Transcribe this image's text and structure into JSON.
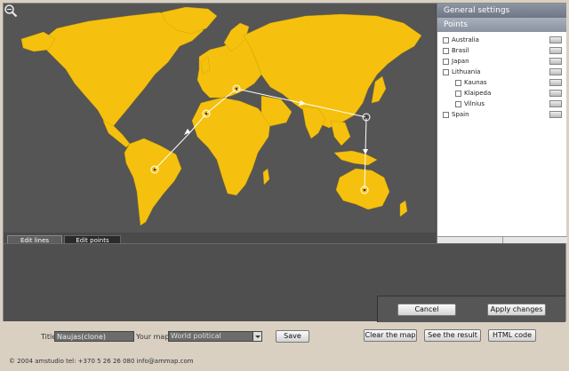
{
  "right_panel": {
    "general_settings": "General settings",
    "points_header": "Points",
    "points": [
      {
        "label": "Australia",
        "level": 0
      },
      {
        "label": "Brasil",
        "level": 0
      },
      {
        "label": "Japan",
        "level": 0
      },
      {
        "label": "Lithuania",
        "level": 0
      },
      {
        "label": "Kaunas",
        "level": 1
      },
      {
        "label": "Klaipeda",
        "level": 1
      },
      {
        "label": "Vilnius",
        "level": 1
      },
      {
        "label": "Spain",
        "level": 0
      }
    ]
  },
  "tabs": {
    "edit_lines": "Edit lines",
    "edit_points": "Edit points"
  },
  "buttons": {
    "cancel": "Cancel",
    "apply": "Apply changes",
    "save": "Save",
    "clear_map": "Clear the map",
    "see_result": "See the result",
    "html_code": "HTML code"
  },
  "form": {
    "title_label": "Title",
    "title_value": "Naujas(clone)",
    "your_map_label": "Your map:",
    "your_map_value": "World political"
  },
  "footer": "© 2004 amstudio tel: +370 5 26 26 080 info@ammap.com",
  "colors": {
    "land": "#f5c10e",
    "ocean": "#555555",
    "route": "#ffffff"
  },
  "icons": {
    "zoom": "magnifier-icon",
    "thumb": "map-thumbnail-icon"
  }
}
